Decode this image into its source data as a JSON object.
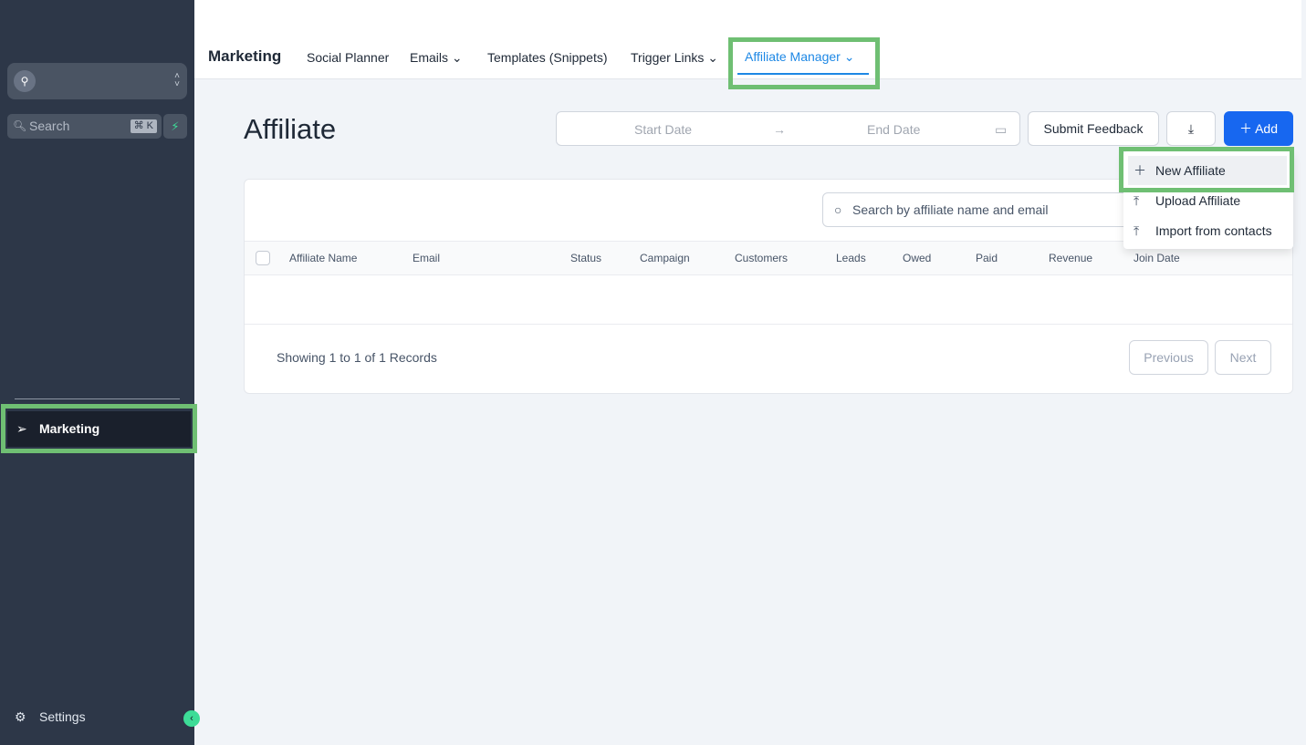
{
  "sidebar": {
    "search_placeholder": "Search",
    "shortcut": "⌘ K",
    "active_item": "Marketing",
    "settings": "Settings",
    "icons": [
      "location-icon",
      "search-icon",
      "lightning-icon",
      "send-icon",
      "gear-icon",
      "chevron-left-icon"
    ]
  },
  "topnav": {
    "title": "Marketing",
    "tabs": [
      {
        "label": "Social Planner"
      },
      {
        "label": "Emails"
      },
      {
        "label": "Templates (Snippets)"
      },
      {
        "label": "Trigger Links"
      },
      {
        "label": "Affiliate Manager"
      }
    ],
    "active_tab": "Affiliate Manager"
  },
  "page": {
    "title": "Affiliate",
    "start_date": "Start Date",
    "end_date": "End Date",
    "submit_feedback": "Submit Feedback",
    "add": "Add"
  },
  "dropdown": {
    "items": [
      {
        "label": "New Affiliate",
        "icon": "plus-icon"
      },
      {
        "label": "Upload Affiliate",
        "icon": "upload-icon"
      },
      {
        "label": "Import from contacts",
        "icon": "upload-icon"
      }
    ]
  },
  "table": {
    "search_placeholder": "Search by affiliate name and email",
    "columns": [
      "Affiliate Name",
      "Email",
      "Status",
      "Campaign",
      "Customers",
      "Leads",
      "Owed",
      "Paid",
      "Revenue",
      "Join Date"
    ],
    "rows": [],
    "showing": "Showing 1 to 1 of 1 Records",
    "previous": "Previous",
    "next": "Next"
  },
  "colors": {
    "accent": "#1767f0",
    "sidebar": "#2d3748",
    "active_tab": "#1e88e5",
    "highlight": "#6fbf73"
  }
}
